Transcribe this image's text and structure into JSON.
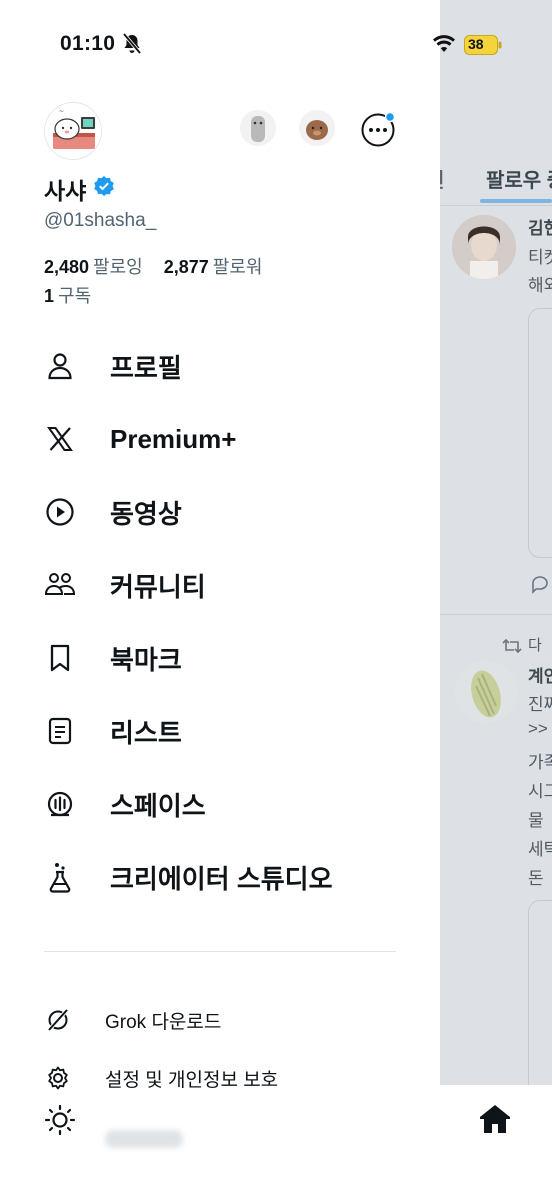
{
  "status_bar": {
    "time": "01:10",
    "battery": "38",
    "battery_color": "#f5d33b"
  },
  "profile": {
    "display_name": "사샤",
    "handle": "@01shasha_",
    "following_count": "2,480",
    "following_label": "팔로잉",
    "followers_count": "2,877",
    "followers_label": "팔로워",
    "subscriptions_count": "1",
    "subscriptions_label": "구독",
    "verified_color": "#1d9bf0"
  },
  "menu": [
    {
      "label": "프로필",
      "icon": "person-icon"
    },
    {
      "label": "Premium+",
      "icon": "x-logo-icon"
    },
    {
      "label": "동영상",
      "icon": "play-circle-icon"
    },
    {
      "label": "커뮤니티",
      "icon": "community-icon"
    },
    {
      "label": "북마크",
      "icon": "bookmark-icon"
    },
    {
      "label": "리스트",
      "icon": "list-icon"
    },
    {
      "label": "스페이스",
      "icon": "spaces-icon"
    },
    {
      "label": "크리에이터 스튜디오",
      "icon": "flask-icon"
    }
  ],
  "secondary_menu": [
    {
      "label": "Grok 다운로드",
      "icon": "grok-icon"
    },
    {
      "label": "설정 및 개인정보 보호",
      "icon": "gear-icon"
    }
  ],
  "background": {
    "tab_partial": "전",
    "tab_active": "팔로우 중",
    "post1_name": "김현",
    "post1_line1": "티켓",
    "post1_line2": "해외",
    "repost_label": "다",
    "post2_name": "계인",
    "post2_lines": [
      "진짜",
      ">>",
      "가족",
      "시그",
      "물",
      "세탁",
      "돈"
    ],
    "accent_color": "#1d9bf0"
  }
}
